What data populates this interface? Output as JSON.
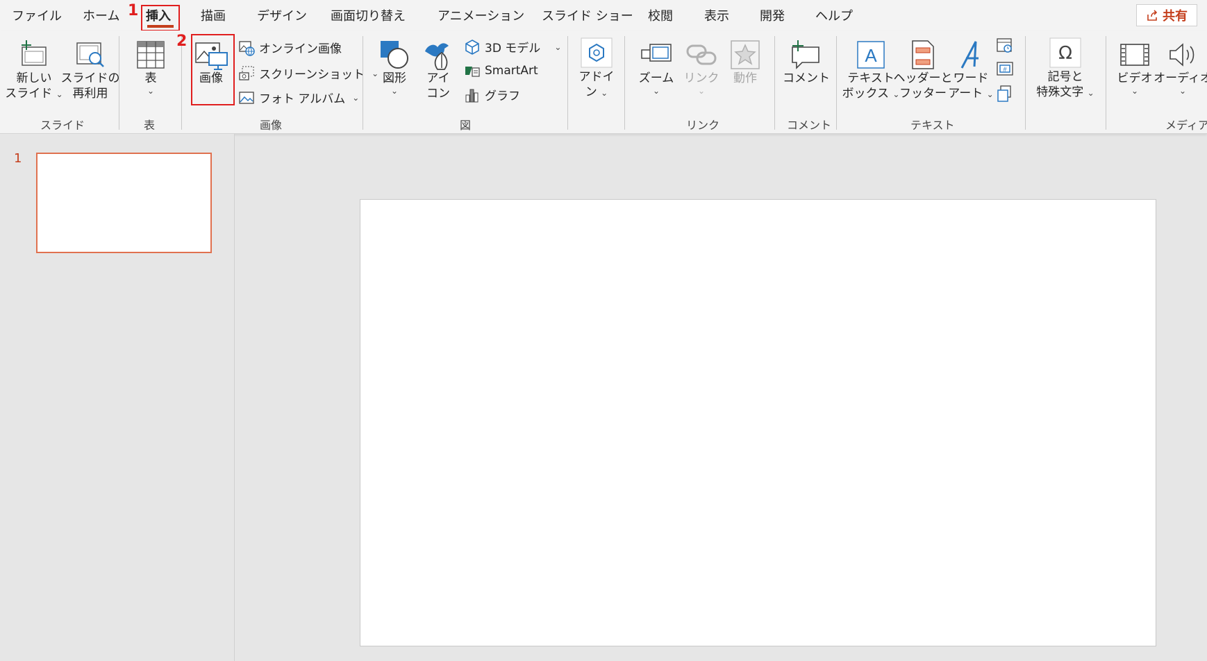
{
  "tabs": [
    "ファイル",
    "ホーム",
    "挿入",
    "描画",
    "デザイン",
    "画面切り替え",
    "アニメーション",
    "スライド ショー",
    "校閲",
    "表示",
    "開発",
    "ヘルプ"
  ],
  "share_label": "共有",
  "annotations": {
    "step1": "1",
    "step2": "2"
  },
  "ribbon": {
    "new_slide": [
      "新しい",
      "スライド"
    ],
    "reuse_slide": [
      "スライドの",
      "再利用"
    ],
    "table": "表",
    "picture": "画像",
    "online_pictures": "オンライン画像",
    "screenshot": "スクリーンショット",
    "photo_album": "フォト アルバム",
    "shapes": "図形",
    "icons": [
      "アイ",
      "コン"
    ],
    "model3d": "3D モデル",
    "smartart": "SmartArt",
    "chart": "グラフ",
    "addins": [
      "アドイ",
      "ン"
    ],
    "zoom": "ズーム",
    "link": "リンク",
    "action": "動作",
    "comment": "コメント",
    "textbox": [
      "テキスト",
      "ボックス"
    ],
    "header_footer": [
      "ヘッダーと",
      "フッター"
    ],
    "wordart": [
      "ワード",
      "アート"
    ],
    "symbols": [
      "記号と",
      "特殊文字"
    ],
    "video": "ビデオ",
    "audio": "オーディオ",
    "groups": {
      "slides": "スライド",
      "tables": "表",
      "images": "画像",
      "illustrations": "図",
      "links": "リンク",
      "comments": "コメント",
      "text": "テキスト",
      "media": "メディア"
    }
  },
  "slide_panel": {
    "slide_number": "1"
  },
  "colors": {
    "accent": "#c43e1c",
    "highlight": "#e01e1e",
    "ribbon_bg": "#f3f3f3",
    "workspace_bg": "#e6e6e6"
  }
}
